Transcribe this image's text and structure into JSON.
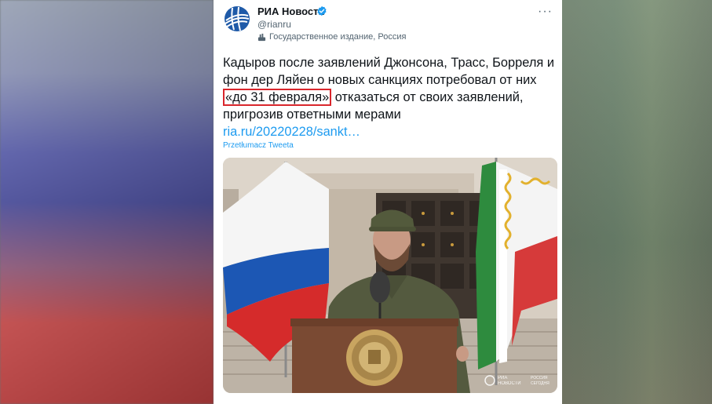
{
  "account": {
    "name": "РИА Новости",
    "handle": "@rianru",
    "label": "Государственное издание, Россия"
  },
  "tweet": {
    "text_before": "Кадыров после заявлений Джонсона, Трасс, Борреля и фон дер Ляйен о новых санкциях потребовал от них",
    "highlight": "«до 31 февраля»",
    "text_after": "отказаться от своих заявлений, пригрозив ответными мерами",
    "link": "ria.ru/20220228/sankt…",
    "translate": "Przetłumacz Tweeta"
  },
  "photo": {
    "watermark_line1": "РИА",
    "watermark_line2": "НОВОСТИ",
    "watermark_line3": "РОССИЯ",
    "watermark_line4": "СЕГОДНЯ"
  },
  "colors": {
    "link": "#1d9bf0",
    "highlight_border": "#d9262c",
    "verified": "#1d9bf0"
  },
  "icons": {
    "more": "more-icon",
    "verified": "verified-badge-icon",
    "state_media": "state-media-icon"
  }
}
